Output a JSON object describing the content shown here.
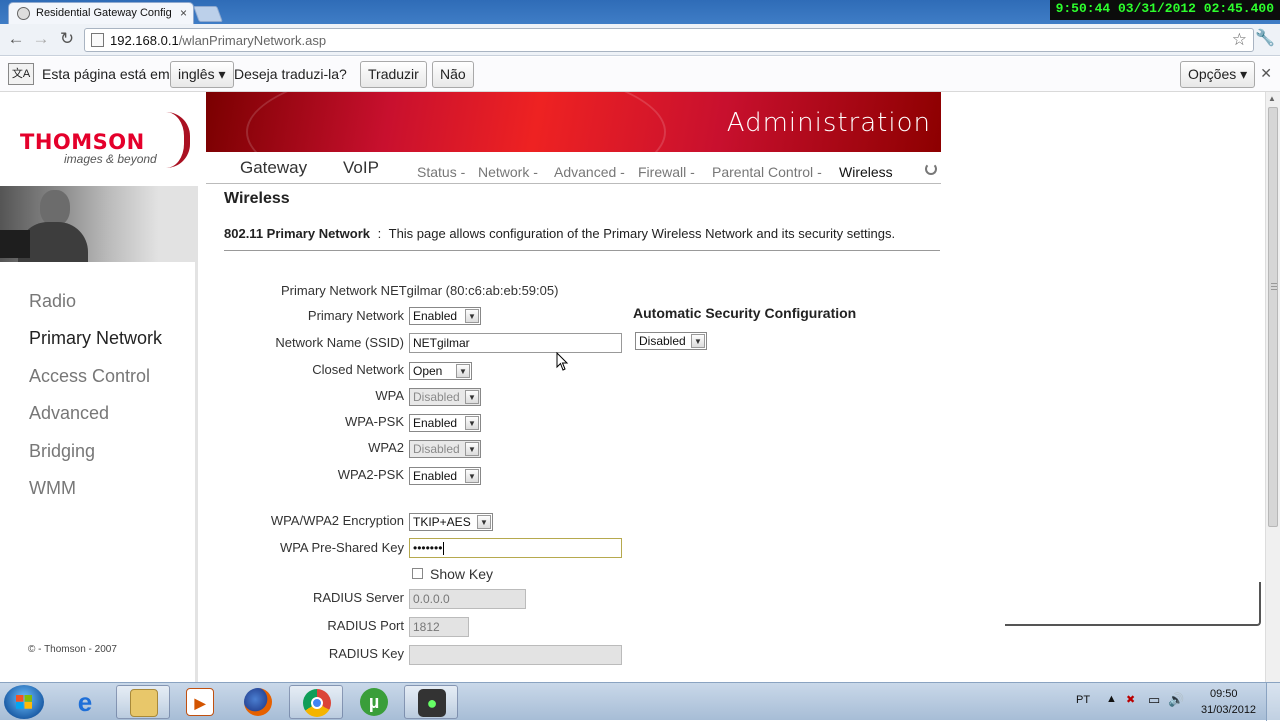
{
  "browser": {
    "tab_title": "Residential Gateway Config",
    "url_host": "192.168.0.1",
    "url_path": "/wlanPrimaryNetwork.asp",
    "overlay_clock": "9:50:44  03/31/2012 02:45.400",
    "translate_bar": {
      "prefix": "Esta página está em",
      "language": "inglês",
      "question": "Deseja traduzi-la?",
      "translate_btn": "Traduzir",
      "no_btn": "Não",
      "options_btn": "Opções"
    }
  },
  "header": {
    "logo": "THOMSON",
    "tagline": "images & beyond",
    "banner_title": "Administration",
    "main_nav": [
      "Gateway",
      "VoIP"
    ],
    "sub_nav": [
      "Status",
      "Network",
      "Advanced",
      "Firewall",
      "Parental Control",
      "Wireless"
    ],
    "sub_nav_sep": "-"
  },
  "sidebar": {
    "items": [
      "Radio",
      "Primary Network",
      "Access Control",
      "Advanced",
      "Bridging",
      "WMM"
    ],
    "active": "Primary Network",
    "copyright": "© - Thomson - 2007"
  },
  "main": {
    "title": "Wireless",
    "desc_bold": "802.11 Primary Network",
    "desc_sep": ":",
    "desc_text": "This page allows configuration of the Primary Wireless Network and its security settings.",
    "network_line": "Primary Network NETgilmar (80:c6:ab:eb:59:05)",
    "auto_sec_title": "Automatic Security Configuration",
    "auto_sec_value": "Disabled",
    "fields": {
      "primary_network": {
        "label": "Primary Network",
        "value": "Enabled"
      },
      "ssid": {
        "label": "Network Name (SSID)",
        "value": "NETgilmar"
      },
      "closed_network": {
        "label": "Closed Network",
        "value": "Open"
      },
      "wpa": {
        "label": "WPA",
        "value": "Disabled"
      },
      "wpa_psk": {
        "label": "WPA-PSK",
        "value": "Enabled"
      },
      "wpa2": {
        "label": "WPA2",
        "value": "Disabled"
      },
      "wpa2_psk": {
        "label": "WPA2-PSK",
        "value": "Enabled"
      },
      "encryption": {
        "label": "WPA/WPA2 Encryption",
        "value": "TKIP+AES"
      },
      "psk": {
        "label": "WPA Pre-Shared Key",
        "value": "•••••••"
      },
      "show_key": {
        "label": "Show Key"
      },
      "radius_server": {
        "label": "RADIUS Server",
        "value": "0.0.0.0"
      },
      "radius_port": {
        "label": "RADIUS Port",
        "value": "1812"
      },
      "radius_key": {
        "label": "RADIUS Key",
        "value": ""
      }
    }
  },
  "taskbar": {
    "lang": "PT",
    "time": "09:50",
    "date": "31/03/2012"
  }
}
